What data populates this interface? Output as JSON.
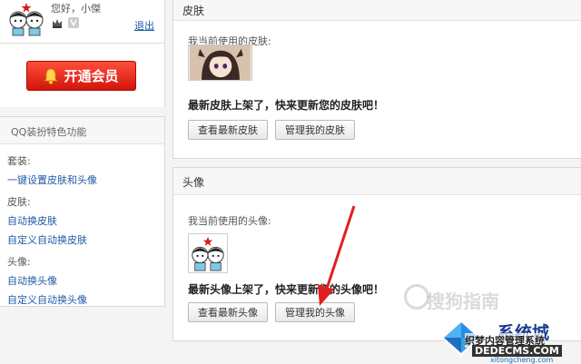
{
  "user": {
    "greeting": "您好，小傑",
    "logout": "退出"
  },
  "vip": {
    "label": "开通会员"
  },
  "features": {
    "title": "QQ装扮特色功能",
    "groups": [
      {
        "category": "套装:",
        "links": [
          "一键设置皮肤和头像"
        ]
      },
      {
        "category": "皮肤:",
        "links": [
          "自动换皮肤",
          "自定义自动换皮肤"
        ]
      },
      {
        "category": "头像:",
        "links": [
          "自动换头像",
          "自定义自动换头像"
        ]
      }
    ]
  },
  "skin_panel": {
    "title": "皮肤",
    "current_label": "我当前使用的皮肤:",
    "hint": "最新皮肤上架了，快来更新您的皮肤吧！",
    "btn_view": "查看最新皮肤",
    "btn_manage": "管理我的皮肤"
  },
  "avatar_panel": {
    "title": "头像",
    "current_label": "我当前使用的头像:",
    "hint": "最新头像上架了，快来更新您的头像吧！",
    "btn_view": "查看最新头像",
    "btn_manage": "管理我的头像"
  },
  "watermark": {
    "sogou": "搜狗指南",
    "site_name": "系统城",
    "site_sub": "织梦内容管理系统",
    "site_url": "DEDECMS.COM",
    "site_small": "xitongcheng.com"
  },
  "colors": {
    "link": "#1f5aa6",
    "vip_red": "#e0261a",
    "arrow_red": "#e02020"
  }
}
